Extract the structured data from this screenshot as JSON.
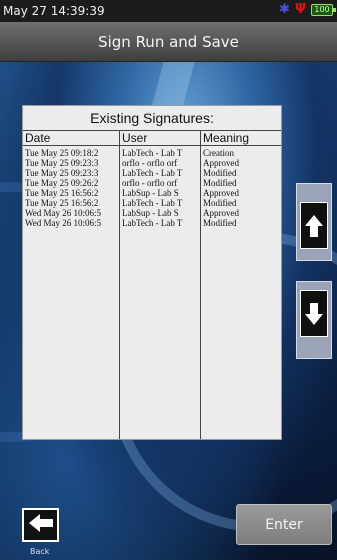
{
  "status": {
    "datetime": "May 27 14:39:39",
    "battery_label": "100"
  },
  "title": "Sign Run and Save",
  "panel": {
    "heading": "Existing Signatures:",
    "columns": [
      "Date",
      "User",
      "Meaning"
    ],
    "rows": [
      {
        "date": "Tue May 25 09:18:2",
        "user": "LabTech - Lab T",
        "meaning": "Creation"
      },
      {
        "date": "Tue May 25 09:23:3",
        "user": "orflo - orflo orf",
        "meaning": "Approved"
      },
      {
        "date": "Tue May 25 09:23:3",
        "user": "LabTech - Lab T",
        "meaning": "Modified"
      },
      {
        "date": "Tue May 25 09:26:2",
        "user": "orflo - orflo orf",
        "meaning": "Modified"
      },
      {
        "date": "Tue May 25 16:56:2",
        "user": "LabSup - Lab S",
        "meaning": "Approved"
      },
      {
        "date": "Tue May 25 16:56:2",
        "user": "LabTech - Lab T",
        "meaning": "Modified"
      },
      {
        "date": "Wed May 26 10:06:5",
        "user": "LabSup - Lab S",
        "meaning": "Approved"
      },
      {
        "date": "Wed May 26 10:06:5",
        "user": "LabTech - Lab T",
        "meaning": "Modified"
      }
    ]
  },
  "footer": {
    "back_label": "Back",
    "enter_label": "Enter"
  },
  "icons": {
    "bluetooth": "bluetooth-icon",
    "usb": "usb-icon",
    "battery": "battery-icon",
    "scroll_up": "arrow-up-icon",
    "scroll_down": "arrow-down-icon",
    "back": "arrow-left-icon"
  },
  "colors": {
    "bluetooth": "#4f4fe0",
    "usb": "#e01010",
    "battery": "#9bdf6a"
  }
}
